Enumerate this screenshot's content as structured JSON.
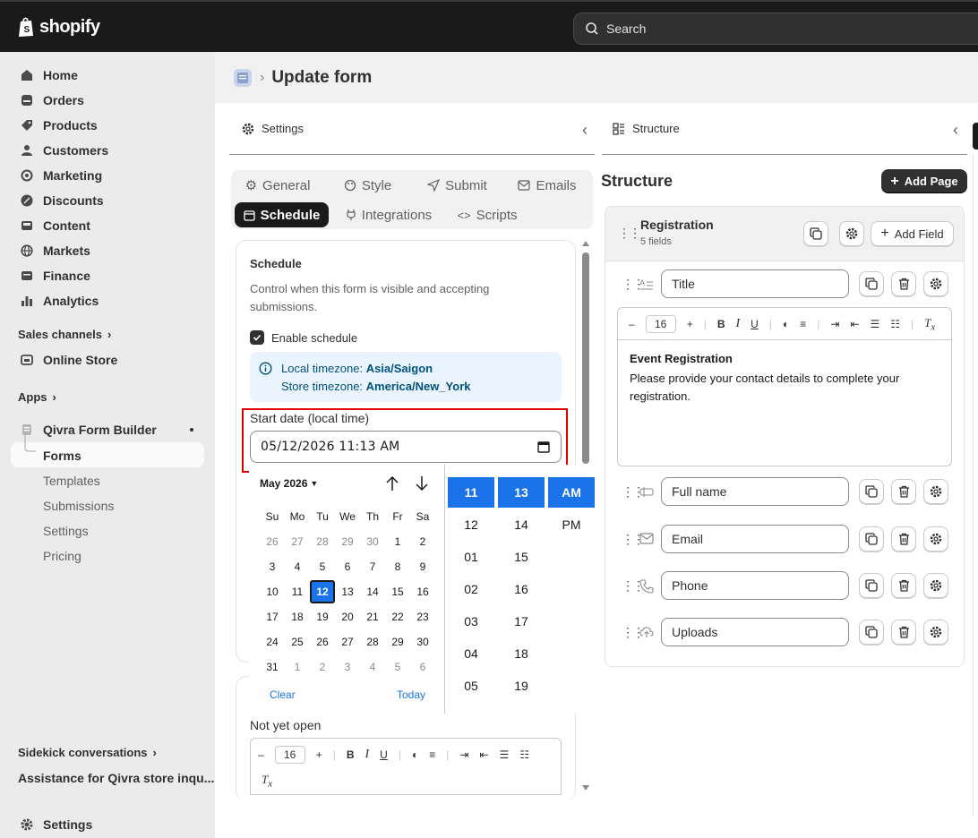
{
  "topbar": {
    "brand": "shopify",
    "search_placeholder": "Search"
  },
  "sidebar": {
    "items": [
      {
        "label": "Home",
        "icon": "home-icon"
      },
      {
        "label": "Orders",
        "icon": "orders-icon"
      },
      {
        "label": "Products",
        "icon": "tag-icon"
      },
      {
        "label": "Customers",
        "icon": "person-icon"
      },
      {
        "label": "Marketing",
        "icon": "target-icon"
      },
      {
        "label": "Discounts",
        "icon": "discount-icon"
      },
      {
        "label": "Content",
        "icon": "content-icon"
      },
      {
        "label": "Markets",
        "icon": "globe-icon"
      },
      {
        "label": "Finance",
        "icon": "bank-icon"
      },
      {
        "label": "Analytics",
        "icon": "bar-chart-icon"
      }
    ],
    "sales_channels_label": "Sales channels",
    "online_store_label": "Online Store",
    "apps_label": "Apps",
    "app_name": "Qivra Form Builder",
    "app_subitems": [
      "Forms",
      "Templates",
      "Submissions",
      "Settings",
      "Pricing"
    ],
    "sidekick_label": "Sidekick conversations",
    "sidekick_item": "Assistance for Qivra store inqu...",
    "settings_label": "Settings"
  },
  "page": {
    "title": "Update form"
  },
  "settings_panel": {
    "header": "Settings",
    "tabs_row1": [
      "General",
      "Style",
      "Submit",
      "Emails"
    ],
    "tabs_row2": [
      "Schedule",
      "Integrations",
      "Scripts"
    ],
    "active_tab": "Schedule",
    "schedule": {
      "heading": "Schedule",
      "description": "Control when this form is visible and accepting submissions.",
      "enable_label": "Enable schedule",
      "enabled": true,
      "local_tz_label": "Local timezone:",
      "local_tz": "Asia/Saigon",
      "store_tz_label": "Store timezone:",
      "store_tz": "America/New_York",
      "start_label": "Start date (local time)",
      "start_value": "05/12/2026 11:13 AM",
      "not_yet_open_label": "Not yet open",
      "font_size": "16"
    }
  },
  "calendar": {
    "month_label": "May 2026",
    "dow": [
      "Su",
      "Mo",
      "Tu",
      "We",
      "Th",
      "Fr",
      "Sa"
    ],
    "weeks": [
      [
        "26",
        "27",
        "28",
        "29",
        "30",
        "1",
        "2"
      ],
      [
        "3",
        "4",
        "5",
        "6",
        "7",
        "8",
        "9"
      ],
      [
        "10",
        "11",
        "12",
        "13",
        "14",
        "15",
        "16"
      ],
      [
        "17",
        "18",
        "19",
        "20",
        "21",
        "22",
        "23"
      ],
      [
        "24",
        "25",
        "26",
        "27",
        "28",
        "29",
        "30"
      ],
      [
        "31",
        "1",
        "2",
        "3",
        "4",
        "5",
        "6"
      ]
    ],
    "selected_day": "12",
    "clear_label": "Clear",
    "today_label": "Today",
    "hours": [
      "11",
      "12",
      "01",
      "02",
      "03",
      "04",
      "05"
    ],
    "minutes": [
      "13",
      "14",
      "15",
      "16",
      "17",
      "18",
      "19"
    ],
    "ampm": [
      "AM",
      "PM"
    ],
    "selected_hour": "11",
    "selected_minute": "13",
    "selected_ampm": "AM"
  },
  "structure_panel": {
    "header": "Structure",
    "title": "Structure",
    "add_page_label": "Add Page",
    "page_name": "Registration",
    "field_count": "5 fields",
    "add_field_label": "Add Field",
    "font_size": "16",
    "rich_text_heading": "Event Registration",
    "rich_text_body": "Please provide your contact details to complete your registration.",
    "fields": [
      {
        "label": "Title",
        "icon": "text-type-icon"
      },
      {
        "label": "Full name",
        "icon": "name-field-icon"
      },
      {
        "label": "Email",
        "icon": "mail-icon"
      },
      {
        "label": "Phone",
        "icon": "phone-icon"
      },
      {
        "label": "Uploads",
        "icon": "upload-icon"
      }
    ]
  },
  "colors": {
    "highlight": "#e00000",
    "accent": "#1a73e8",
    "dark": "#1a1a1a"
  }
}
